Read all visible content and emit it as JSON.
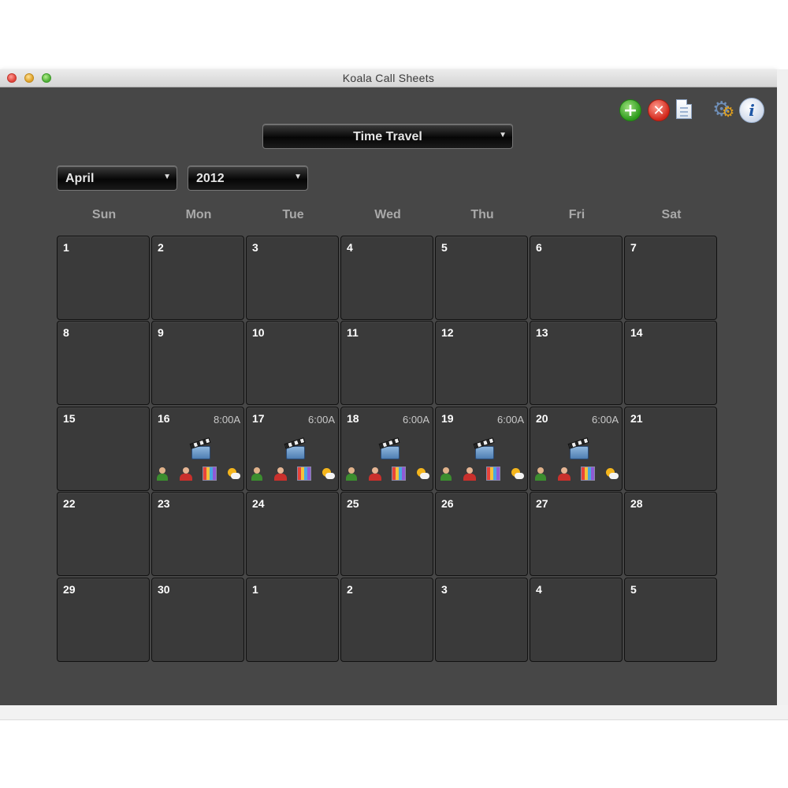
{
  "window": {
    "title": "Koala Call Sheets"
  },
  "toolbar": {
    "icons": [
      "add-icon",
      "delete-icon",
      "document-icon",
      "settings-icon",
      "info-icon"
    ]
  },
  "project_select": {
    "value": "Time Travel"
  },
  "month_select": {
    "value": "April"
  },
  "year_select": {
    "value": "2012"
  },
  "weekdays": [
    "Sun",
    "Mon",
    "Tue",
    "Wed",
    "Thu",
    "Fri",
    "Sat"
  ],
  "weeks": [
    [
      {
        "day": "1"
      },
      {
        "day": "2"
      },
      {
        "day": "3"
      },
      {
        "day": "4"
      },
      {
        "day": "5"
      },
      {
        "day": "6"
      },
      {
        "day": "7"
      }
    ],
    [
      {
        "day": "8"
      },
      {
        "day": "9"
      },
      {
        "day": "10"
      },
      {
        "day": "11"
      },
      {
        "day": "12"
      },
      {
        "day": "13"
      },
      {
        "day": "14"
      }
    ],
    [
      {
        "day": "15"
      },
      {
        "day": "16",
        "call_time": "8:00A",
        "shoot": true
      },
      {
        "day": "17",
        "call_time": "6:00A",
        "shoot": true
      },
      {
        "day": "18",
        "call_time": "6:00A",
        "shoot": true
      },
      {
        "day": "19",
        "call_time": "6:00A",
        "shoot": true
      },
      {
        "day": "20",
        "call_time": "6:00A",
        "shoot": true
      },
      {
        "day": "21"
      }
    ],
    [
      {
        "day": "22"
      },
      {
        "day": "23"
      },
      {
        "day": "24"
      },
      {
        "day": "25"
      },
      {
        "day": "26"
      },
      {
        "day": "27"
      },
      {
        "day": "28"
      }
    ],
    [
      {
        "day": "29"
      },
      {
        "day": "30"
      },
      {
        "day": "1"
      },
      {
        "day": "2"
      },
      {
        "day": "3"
      },
      {
        "day": "4"
      },
      {
        "day": "5"
      }
    ]
  ],
  "shoot_day_icons": [
    "clapperboard-icon",
    "actor-icon",
    "crew-icon",
    "schedule-icon",
    "weather-icon"
  ]
}
